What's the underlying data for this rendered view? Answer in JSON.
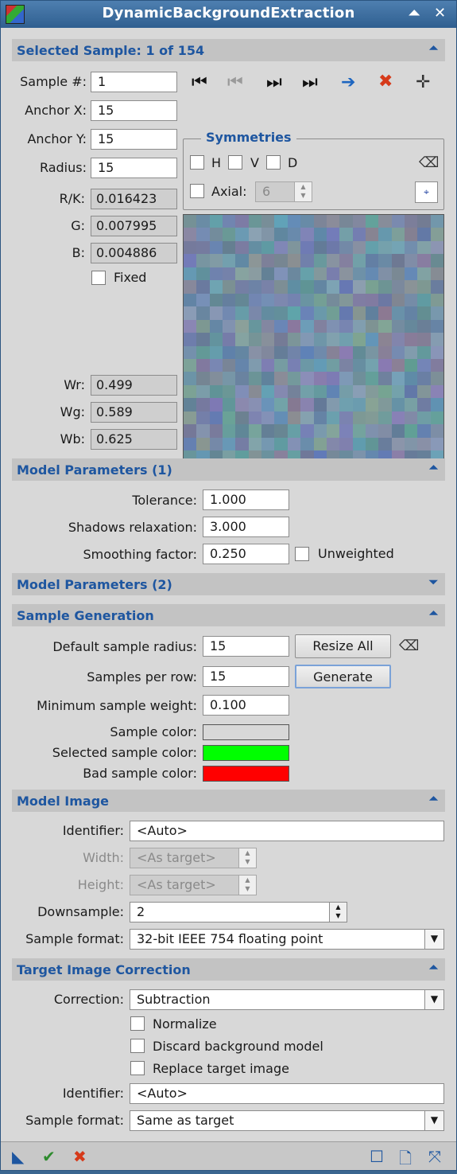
{
  "window": {
    "title": "DynamicBackgroundExtraction"
  },
  "selected_sample": {
    "header": "Selected Sample: 1 of 154",
    "sample_label": "Sample #:",
    "sample_value": "1",
    "anchor_x_label": "Anchor X:",
    "anchor_x_value": "15",
    "anchor_y_label": "Anchor Y:",
    "anchor_y_value": "15",
    "radius_label": "Radius:",
    "radius_value": "15",
    "rk_label": "R/K:",
    "rk_value": "0.016423",
    "g_label": "G:",
    "g_value": "0.007995",
    "b_label": "B:",
    "b_value": "0.004886",
    "fixed_label": "Fixed",
    "wr_label": "Wr:",
    "wr_value": "0.499",
    "wg_label": "Wg:",
    "wg_value": "0.589",
    "wb_label": "Wb:",
    "wb_value": "0.625",
    "symmetries": {
      "title": "Symmetries",
      "h": "H",
      "v": "V",
      "d": "D",
      "axial_label": "Axial:",
      "axial_value": "6"
    }
  },
  "model_params_1": {
    "header": "Model Parameters (1)",
    "tolerance_label": "Tolerance:",
    "tolerance_value": "1.000",
    "shadows_label": "Shadows relaxation:",
    "shadows_value": "3.000",
    "smoothing_label": "Smoothing factor:",
    "smoothing_value": "0.250",
    "unweighted_label": "Unweighted"
  },
  "model_params_2": {
    "header": "Model Parameters (2)"
  },
  "sample_generation": {
    "header": "Sample Generation",
    "default_radius_label": "Default sample radius:",
    "default_radius_value": "15",
    "resize_all": "Resize All",
    "per_row_label": "Samples per row:",
    "per_row_value": "15",
    "generate": "Generate",
    "min_weight_label": "Minimum sample weight:",
    "min_weight_value": "0.100",
    "sample_color_label": "Sample color:",
    "sample_color": "#d8d8d8",
    "selected_color_label": "Selected sample color:",
    "selected_color": "#00ff00",
    "bad_color_label": "Bad sample color:",
    "bad_color": "#ff0000"
  },
  "model_image": {
    "header": "Model Image",
    "identifier_label": "Identifier:",
    "identifier_value": "<Auto>",
    "width_label": "Width:",
    "width_value": "<As target>",
    "height_label": "Height:",
    "height_value": "<As target>",
    "downsample_label": "Downsample:",
    "downsample_value": "2",
    "format_label": "Sample format:",
    "format_value": "32-bit IEEE 754 floating point"
  },
  "target_correction": {
    "header": "Target Image Correction",
    "correction_label": "Correction:",
    "correction_value": "Subtraction",
    "normalize": "Normalize",
    "discard": "Discard background model",
    "replace": "Replace target image",
    "identifier_label": "Identifier:",
    "identifier_value": "<Auto>",
    "format_label": "Sample format:",
    "format_value": "Same as target"
  },
  "colors": {
    "accent": "#1e56a0",
    "titlebar": "#3b6a9a",
    "delete": "#d63a1a",
    "apply": "#2e8b2e"
  }
}
